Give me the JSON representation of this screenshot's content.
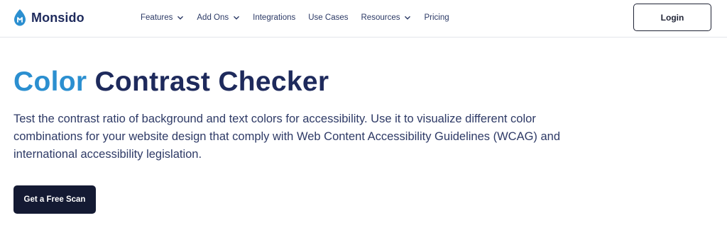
{
  "brand": {
    "name": "Monsido"
  },
  "nav": {
    "items": [
      {
        "label": "Features",
        "has_dropdown": true
      },
      {
        "label": "Add Ons",
        "has_dropdown": true
      },
      {
        "label": "Integrations",
        "has_dropdown": false
      },
      {
        "label": "Use Cases",
        "has_dropdown": false
      },
      {
        "label": "Resources",
        "has_dropdown": true
      },
      {
        "label": "Pricing",
        "has_dropdown": false
      }
    ],
    "login_label": "Login"
  },
  "hero": {
    "title_accent": "Color",
    "title_rest": "Contrast Checker",
    "description": "Test the contrast ratio of background and text colors for accessibility. Use it to visualize different color combinations for your website design that comply with Web Content Accessibility Guidelines (WCAG) and international accessibility legislation.",
    "cta_label": "Get a Free Scan"
  },
  "colors": {
    "accent": "#2b8fd0",
    "navy": "#1e2a5c",
    "cta_bg": "#141a33"
  }
}
